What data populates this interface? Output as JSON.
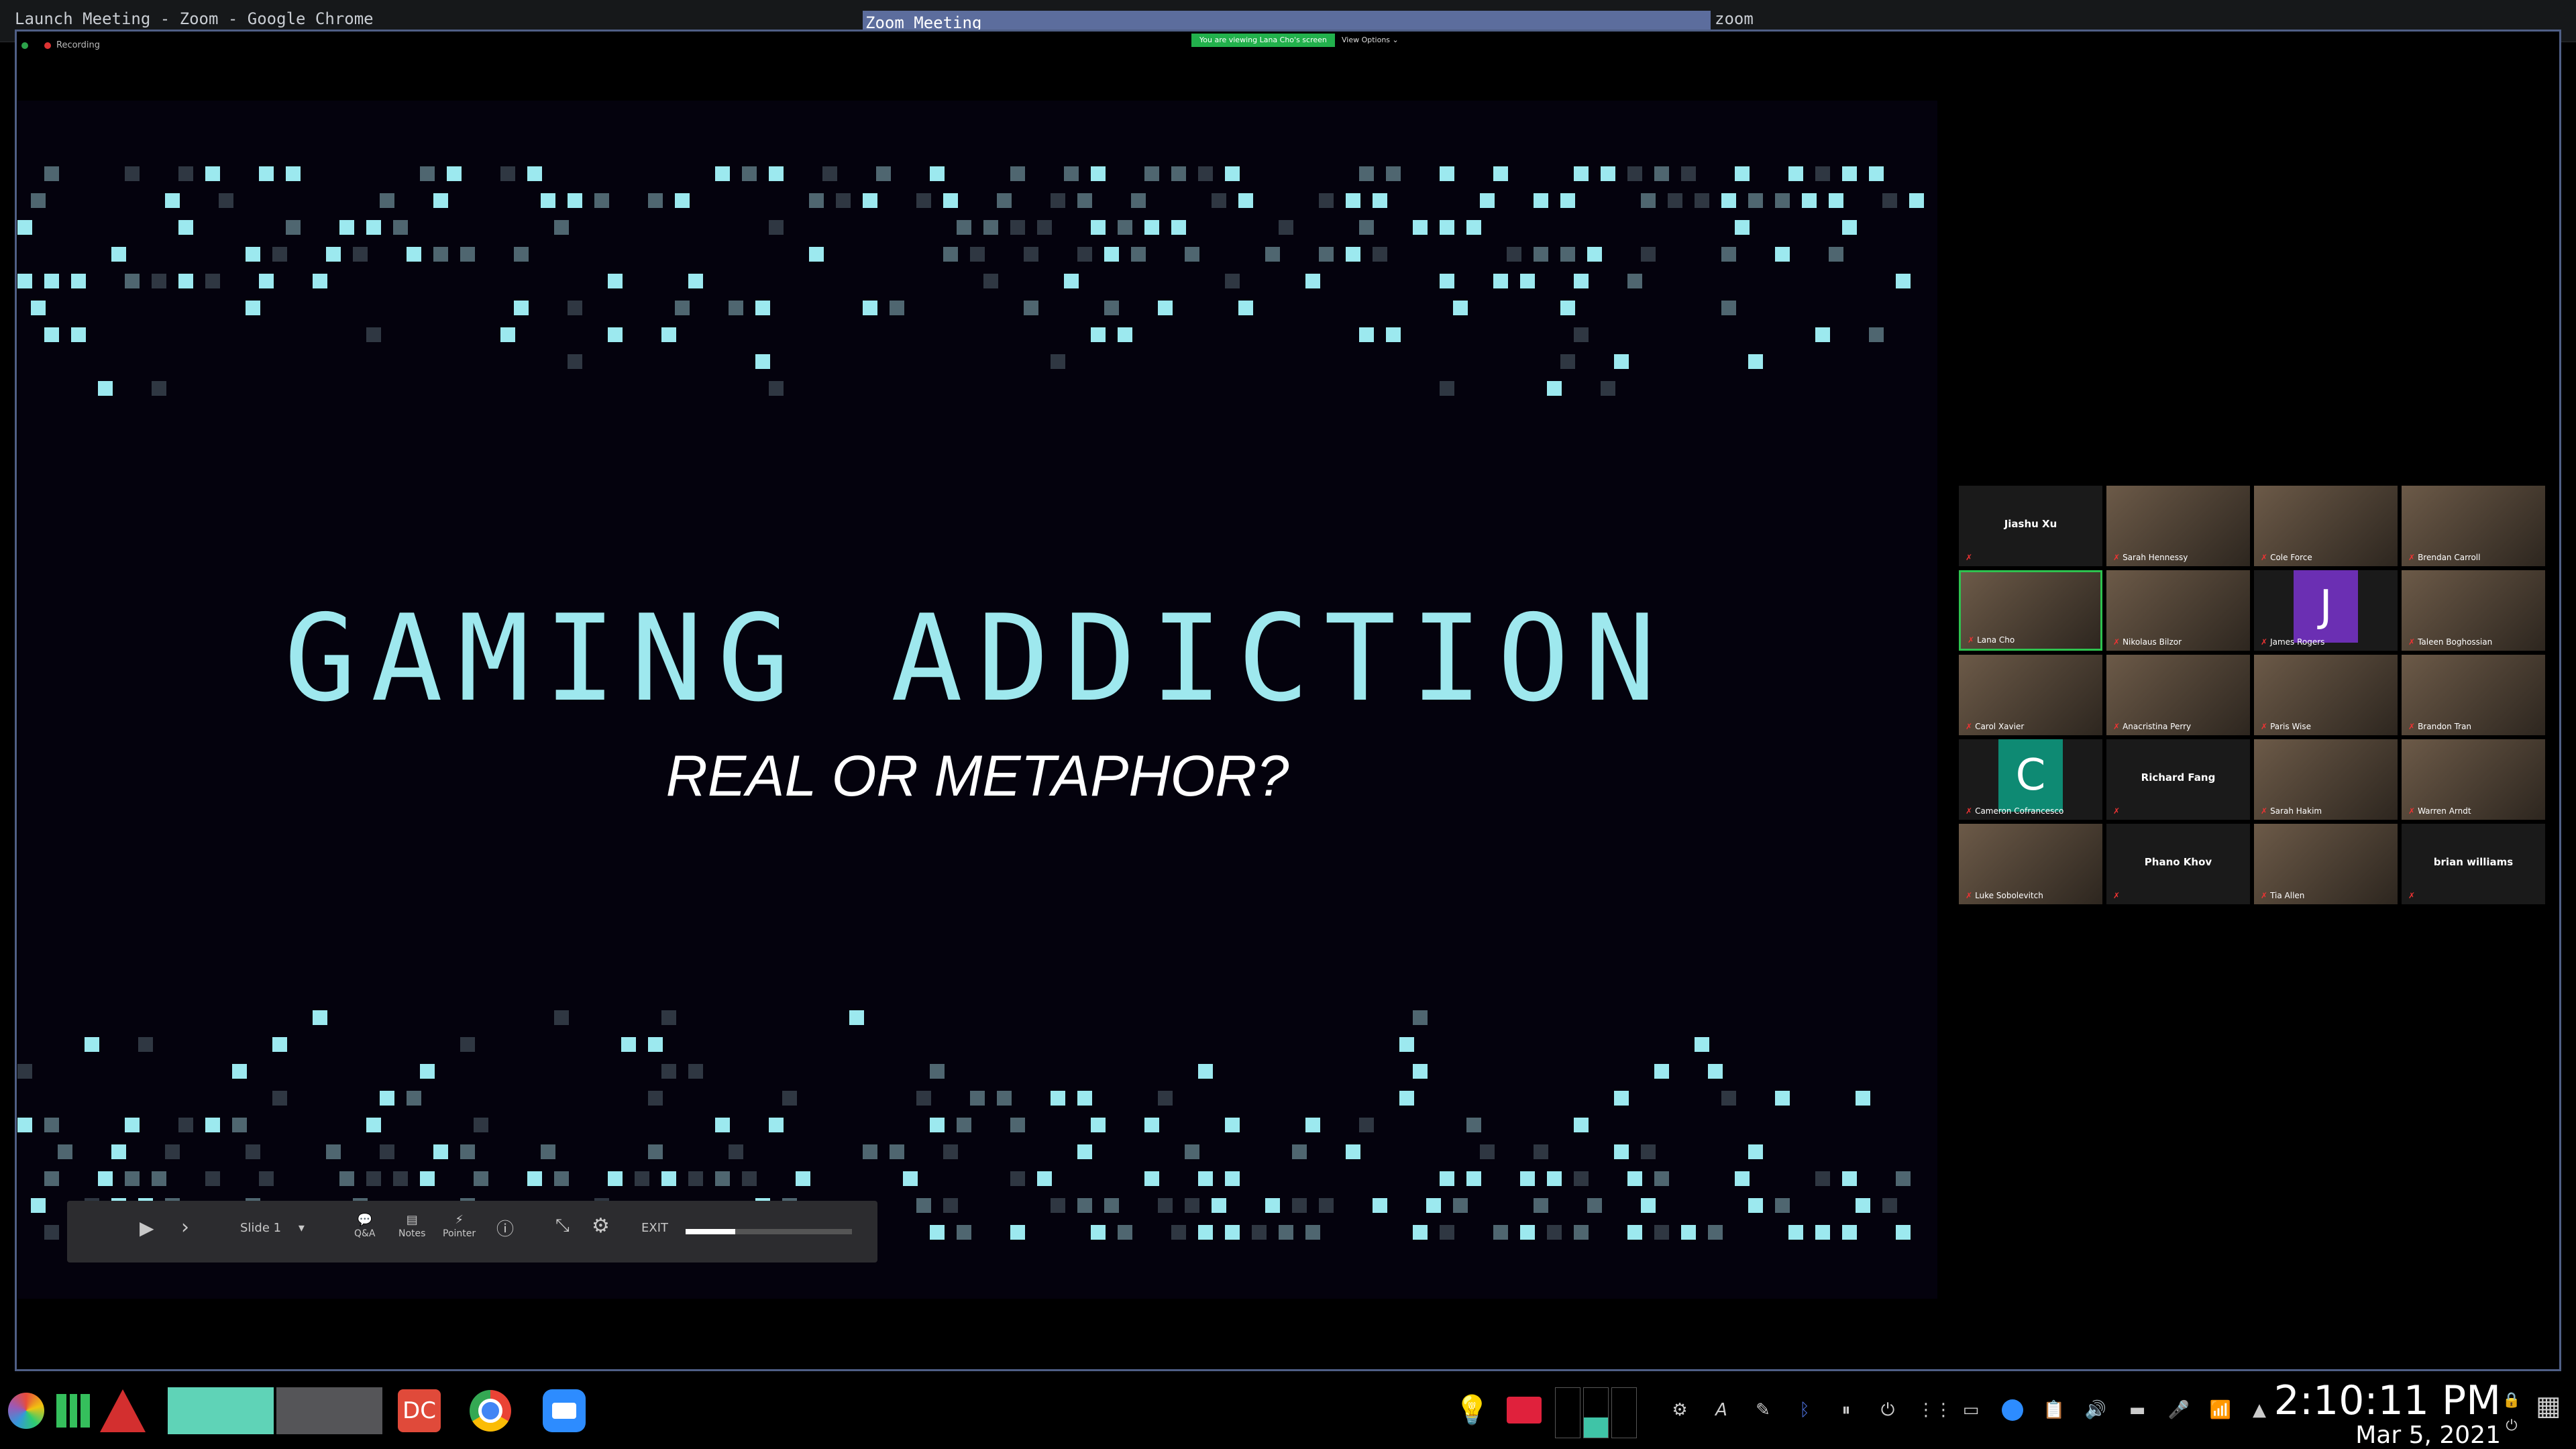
{
  "window": {
    "chrome_title": "Launch Meeting - Zoom - Google Chrome",
    "zoom_title": "Zoom Meeting",
    "app_label": "zoom",
    "recording_label": "Recording",
    "viewing_notice": "You are viewing Lana Cho's screen",
    "view_options": "View Options ⌄"
  },
  "slide": {
    "title": "GAMING ADDICTION",
    "subtitle": "REAL OR METAPHOR?",
    "toolbar": {
      "slide_label": "Slide 1",
      "qa_label": "Q&A",
      "notes_label": "Notes",
      "pointer_label": "Pointer",
      "exit_label": "EXIT",
      "progress": 0.3
    }
  },
  "participants": [
    {
      "name": "Jiashu Xu",
      "type": "name"
    },
    {
      "name": "Sarah Hennessy",
      "type": "video"
    },
    {
      "name": "Cole Force",
      "type": "video"
    },
    {
      "name": "Brendan Carroll",
      "type": "video"
    },
    {
      "name": "Lana Cho",
      "type": "video",
      "speaking": true
    },
    {
      "name": "Nikolaus Bilzor",
      "type": "video"
    },
    {
      "name": "James Rogers",
      "type": "avatar",
      "initial": "J",
      "color": "#6b2fb3"
    },
    {
      "name": "Taleen Boghossian",
      "type": "video"
    },
    {
      "name": "Carol Xavier",
      "type": "video"
    },
    {
      "name": "Anacristina Perry",
      "type": "video"
    },
    {
      "name": "Paris Wise",
      "type": "video"
    },
    {
      "name": "Brandon Tran",
      "type": "video"
    },
    {
      "name": "Cameron Cofrancesco",
      "type": "avatar",
      "initial": "C",
      "color": "#0e8a73"
    },
    {
      "name": "Richard Fang",
      "type": "name"
    },
    {
      "name": "Sarah Hakim",
      "type": "video"
    },
    {
      "name": "Warren Arndt",
      "type": "video"
    },
    {
      "name": "Luke Sobolevitch",
      "type": "video"
    },
    {
      "name": "Phano Khov",
      "type": "name"
    },
    {
      "name": "Tia Allen",
      "type": "video"
    },
    {
      "name": "brian williams",
      "type": "name"
    }
  ],
  "taskbar": {
    "apps": [
      "pinwheel-icon",
      "manjaro-icon",
      "red-triangle-icon",
      "window-1",
      "window-2",
      "dc-icon",
      "chrome-icon",
      "zoom-icon"
    ],
    "tray_icons": [
      "bulb-icon",
      "folder-icon",
      "workspaces",
      "settings-icon",
      "font-icon",
      "pen-icon",
      "bluetooth-icon",
      "pause-icon",
      "power-icon",
      "grid-icon",
      "monitor-icon",
      "zoom-tray-icon",
      "clipboard-icon",
      "volume-icon",
      "battery-icon",
      "mic-icon",
      "wifi-icon",
      "up-arrow-icon"
    ],
    "clock_time": "2:10:11 PM",
    "clock_date": "Mar 5, 2021"
  }
}
